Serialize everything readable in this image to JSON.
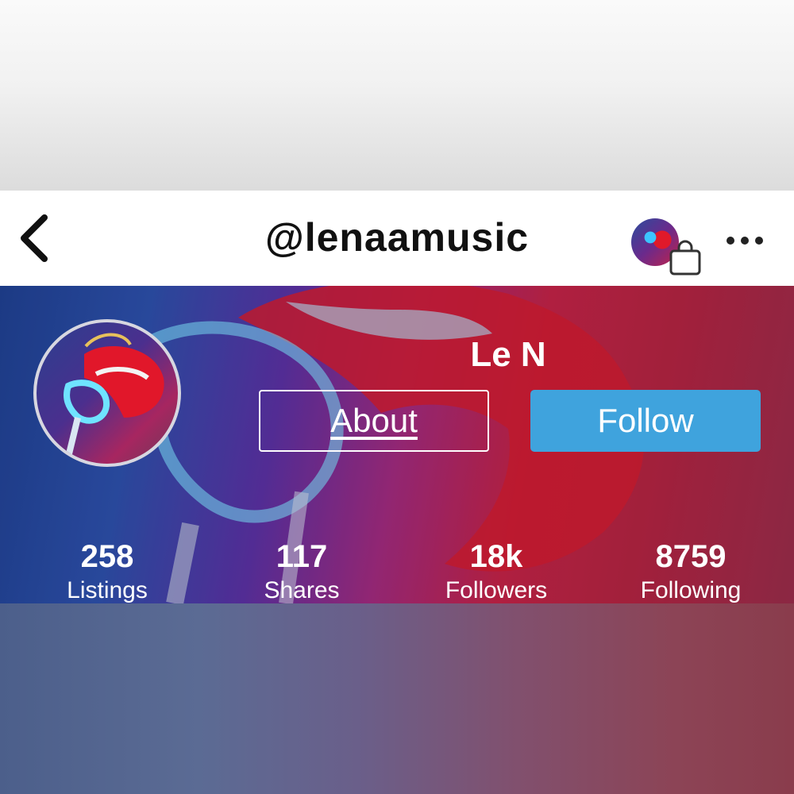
{
  "header": {
    "title": "@lenaamusic",
    "back_icon": "chevron-left-icon",
    "avatar_icon": "shop-avatar",
    "bag_icon": "shopping-bag-icon",
    "more_icon": "more-horizontal-icon"
  },
  "profile": {
    "display_name": "Le N",
    "about_label": "About",
    "follow_label": "Follow"
  },
  "stats": [
    {
      "value": "258",
      "label": "Listings"
    },
    {
      "value": "117",
      "label": "Shares"
    },
    {
      "value": "18k",
      "label": "Followers"
    },
    {
      "value": "8759",
      "label": "Following"
    }
  ],
  "colors": {
    "follow_button": "#3fa3dd",
    "nav_background": "#ffffff",
    "text_on_hero": "#ffffff"
  }
}
